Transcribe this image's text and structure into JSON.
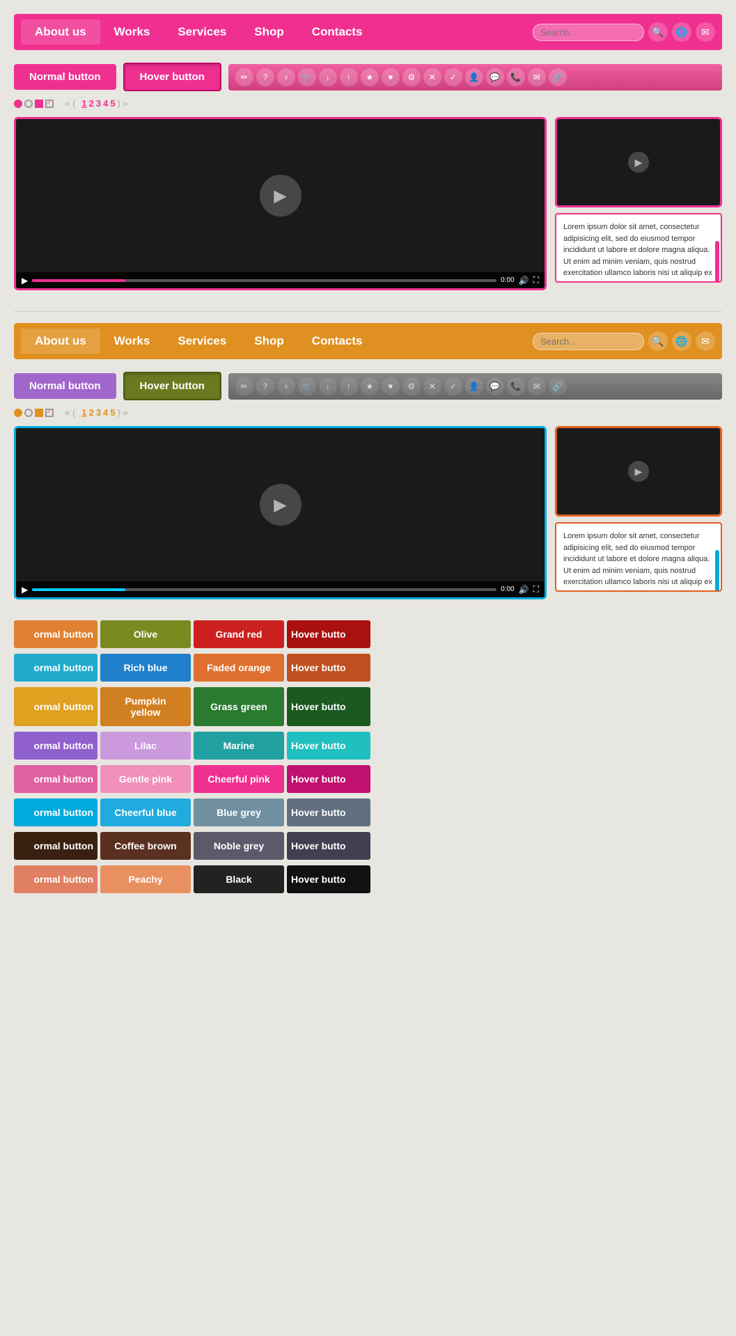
{
  "pink_nav": {
    "items": [
      "About us",
      "Works",
      "Services",
      "Shop",
      "Contacts"
    ],
    "active_index": 2,
    "search_placeholder": "Search...",
    "icons": [
      "🔍",
      "🌐",
      "✉"
    ]
  },
  "pink_buttons": {
    "normal_label": "Normal button",
    "hover_label": "Hover button"
  },
  "orange_nav": {
    "items": [
      "About us",
      "Works",
      "Services",
      "Shop",
      "Contacts"
    ],
    "active_index": 2,
    "search_placeholder": "Search...",
    "icons": [
      "🔍",
      "🌐",
      "✉"
    ]
  },
  "orange_buttons": {
    "normal_label": "Normal button",
    "hover_label": "Hover button"
  },
  "lorem_text": "Lorem ipsum dolor sit amet, consectetur adipisicing elit, sed do eiusmod tempor incididunt ut labore et dolore magna aliqua. Ut enim ad minim veniam, quis nostrud exercitation ullamco laboris nisi ut aliquip ex ea commodo consequat. Duis aute irure dolor in reprehenderit cillum dolore eu fugiat nulla pariatur. Excepteur sint occaecat cupidatat enim ad minim veniam, quis nostrud exercitation ullamco",
  "pagination": {
    "pages": [
      "1",
      "2",
      "3",
      "4",
      "5"
    ],
    "current": "1"
  },
  "colors": {
    "rows": [
      {
        "normal_bg": "#e08030",
        "name": "Olive",
        "name_bg": "#7a8a20",
        "accent": "Grand red",
        "accent_bg": "#cc2020",
        "hover_bg": "#cc2020"
      },
      {
        "normal_bg": "#20aacc",
        "name": "Rich blue",
        "name_bg": "#2080cc",
        "accent": "Faded orange",
        "accent_bg": "#e07030",
        "hover_bg": "#e07030"
      },
      {
        "normal_bg": "#e0a020",
        "name": "Pumpkin yellow",
        "name_bg": "#d08020",
        "accent": "Grass green",
        "accent_bg": "#2a7a30",
        "hover_bg": "#1a5a20"
      },
      {
        "normal_bg": "#9060cc",
        "name": "Lilac",
        "name_bg": "#cc99dd",
        "accent": "Marine",
        "accent_bg": "#20a0a0",
        "hover_bg": "#20c0c0"
      },
      {
        "normal_bg": "#e060a0",
        "name": "Gentle pink",
        "name_bg": "#f090bb",
        "accent": "Cheerful pink",
        "accent_bg": "#f03090",
        "hover_bg": "#f03090"
      },
      {
        "normal_bg": "#00aadd",
        "name": "Cheerful blue",
        "name_bg": "#20aadd",
        "accent": "Blue grey",
        "accent_bg": "#7090a0",
        "hover_bg": "#607080"
      },
      {
        "normal_bg": "#3a2010",
        "name": "Coffee brown",
        "name_bg": "#5a3020",
        "accent": "Noble grey",
        "accent_bg": "#5a5a6a",
        "hover_bg": "#404050"
      },
      {
        "normal_bg": "#e08060",
        "name": "Peachy",
        "name_bg": "#e89060",
        "accent": "Black",
        "accent_bg": "#222222",
        "hover_bg": "#111111"
      }
    ]
  },
  "icon_symbols": [
    "✏",
    "?",
    "♀",
    "🛒",
    "↓",
    "↑",
    "★",
    "♥",
    "⚙",
    "✕",
    "✓",
    "👤",
    "💬",
    "📞",
    "✉",
    "🔗"
  ],
  "video_controls": {
    "play": "▶",
    "volume": "🔊",
    "fullscreen": "⛶",
    "time": "0:00"
  }
}
